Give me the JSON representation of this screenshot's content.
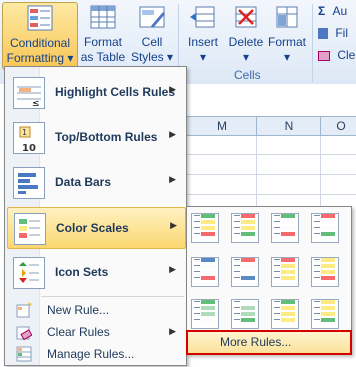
{
  "ribbon": {
    "conditional_formatting": {
      "line1": "Conditional",
      "line2": "Formatting ▾"
    },
    "format_as_table": {
      "line1": "Format",
      "line2": "as Table ▾"
    },
    "cell_styles": {
      "line1": "Cell",
      "line2": "Styles ▾"
    },
    "insert": {
      "line1": "Insert",
      "line2": "▾"
    },
    "delete": {
      "line1": "Delete",
      "line2": "▾"
    },
    "format": {
      "line1": "Format",
      "line2": "▾"
    },
    "cells_group_label": "Cells",
    "autosum_label": "Au",
    "fill_label": "Fil",
    "clear_label": "Cle",
    "sigma_glyph": "Σ"
  },
  "columns": [
    "M",
    "N",
    "O"
  ],
  "menu": {
    "items": [
      {
        "label": "Highlight Cells Rules",
        "has_arrow": true
      },
      {
        "label": "Top/Bottom Rules",
        "has_arrow": true
      },
      {
        "label": "Data Bars",
        "has_arrow": true
      },
      {
        "label": "Color Scales",
        "has_arrow": true,
        "highlighted": true
      },
      {
        "label": "Icon Sets",
        "has_arrow": true
      }
    ],
    "small_items": [
      {
        "label": "New Rule...",
        "has_arrow": false
      },
      {
        "label": "Clear Rules",
        "has_arrow": true
      },
      {
        "label": "Manage Rules...",
        "has_arrow": false
      }
    ],
    "arrow_glyph": "▶"
  },
  "color_scales": {
    "rows": [
      [
        [
          "#63be7b",
          "#ffeb84",
          "#f8696b"
        ],
        [
          "#f8696b",
          "#ffeb84",
          "#63be7b"
        ],
        [
          "#63be7b",
          "#fcfcff",
          "#f8696b"
        ],
        [
          "#f8696b",
          "#fcfcff",
          "#63be7b"
        ]
      ],
      [
        [
          "#5a8ac6",
          "#fcfcff",
          "#f8696b"
        ],
        [
          "#f8696b",
          "#fcfcff",
          "#5a8ac6"
        ],
        [
          "#f8696b",
          "#ffeb84",
          "#ffeb84"
        ],
        [
          "#ffeb84",
          "#ffeb84",
          "#f8696b"
        ]
      ],
      [
        [
          "#63be7b",
          "#b0dcbc",
          "#fcfcff"
        ],
        [
          "#fcfcff",
          "#b0dcbc",
          "#63be7b"
        ],
        [
          "#63be7b",
          "#ffeb84",
          "#ffeb84"
        ],
        [
          "#ffeb84",
          "#ffeb84",
          "#63be7b"
        ]
      ]
    ]
  },
  "more_rules_label": "More Rules..."
}
